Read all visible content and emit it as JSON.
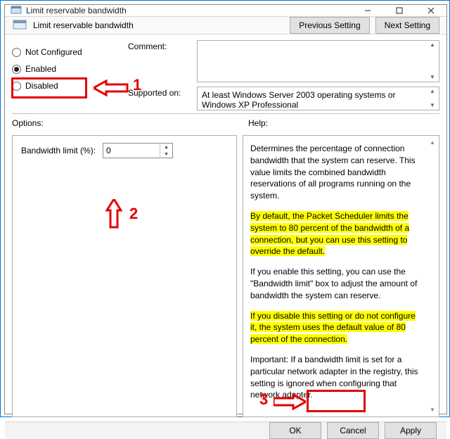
{
  "window": {
    "title": "Limit reservable bandwidth"
  },
  "subheader": {
    "label": "Limit reservable bandwidth",
    "prev": "Previous Setting",
    "next": "Next Setting"
  },
  "state": {
    "not_configured": "Not Configured",
    "enabled": "Enabled",
    "disabled": "Disabled",
    "selected": "enabled"
  },
  "labels": {
    "comment": "Comment:",
    "supported_on": "Supported on:",
    "options": "Options:",
    "help": "Help:"
  },
  "comment_value": "",
  "supported_text": "At least Windows Server 2003 operating systems or Windows XP Professional",
  "options": {
    "bandwidth_label": "Bandwidth limit (%):",
    "bandwidth_value": "0"
  },
  "help": {
    "p1": "Determines the percentage of connection bandwidth that the system can reserve. This value limits the combined bandwidth reservations of all programs running on the system.",
    "p2": "By default, the Packet Scheduler limits the system to 80 percent of the bandwidth of a connection, but you can use this setting to override the default.",
    "p3": "If you enable this setting, you can use the \"Bandwidth limit\" box to adjust the amount of bandwidth the system can reserve.",
    "p4": "If you disable this setting or do not configure it, the system uses the default value of 80 percent of the connection.",
    "p5": "Important: If a bandwidth limit is set for a particular network adapter in the registry, this setting is ignored when configuring that network adapter."
  },
  "footer": {
    "ok": "OK",
    "cancel": "Cancel",
    "apply": "Apply"
  },
  "annotations": {
    "n1": "1",
    "n2": "2",
    "n3": "3"
  }
}
